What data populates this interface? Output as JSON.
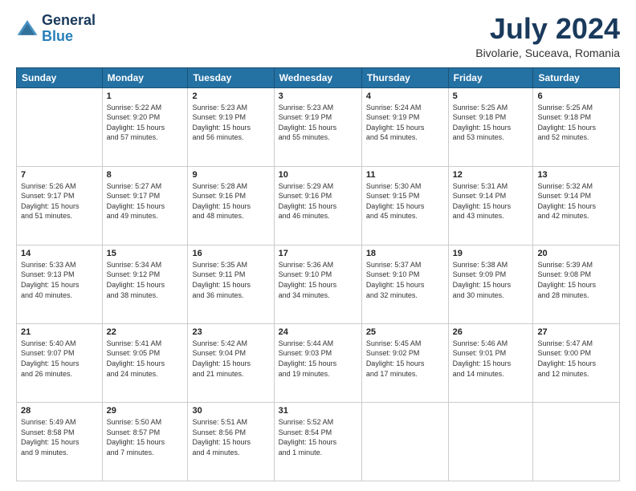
{
  "logo": {
    "line1": "General",
    "line2": "Blue"
  },
  "title": "July 2024",
  "location": "Bivolarie, Suceava, Romania",
  "header_days": [
    "Sunday",
    "Monday",
    "Tuesday",
    "Wednesday",
    "Thursday",
    "Friday",
    "Saturday"
  ],
  "weeks": [
    [
      {
        "day": "",
        "info": ""
      },
      {
        "day": "1",
        "info": "Sunrise: 5:22 AM\nSunset: 9:20 PM\nDaylight: 15 hours\nand 57 minutes."
      },
      {
        "day": "2",
        "info": "Sunrise: 5:23 AM\nSunset: 9:19 PM\nDaylight: 15 hours\nand 56 minutes."
      },
      {
        "day": "3",
        "info": "Sunrise: 5:23 AM\nSunset: 9:19 PM\nDaylight: 15 hours\nand 55 minutes."
      },
      {
        "day": "4",
        "info": "Sunrise: 5:24 AM\nSunset: 9:19 PM\nDaylight: 15 hours\nand 54 minutes."
      },
      {
        "day": "5",
        "info": "Sunrise: 5:25 AM\nSunset: 9:18 PM\nDaylight: 15 hours\nand 53 minutes."
      },
      {
        "day": "6",
        "info": "Sunrise: 5:25 AM\nSunset: 9:18 PM\nDaylight: 15 hours\nand 52 minutes."
      }
    ],
    [
      {
        "day": "7",
        "info": "Sunrise: 5:26 AM\nSunset: 9:17 PM\nDaylight: 15 hours\nand 51 minutes."
      },
      {
        "day": "8",
        "info": "Sunrise: 5:27 AM\nSunset: 9:17 PM\nDaylight: 15 hours\nand 49 minutes."
      },
      {
        "day": "9",
        "info": "Sunrise: 5:28 AM\nSunset: 9:16 PM\nDaylight: 15 hours\nand 48 minutes."
      },
      {
        "day": "10",
        "info": "Sunrise: 5:29 AM\nSunset: 9:16 PM\nDaylight: 15 hours\nand 46 minutes."
      },
      {
        "day": "11",
        "info": "Sunrise: 5:30 AM\nSunset: 9:15 PM\nDaylight: 15 hours\nand 45 minutes."
      },
      {
        "day": "12",
        "info": "Sunrise: 5:31 AM\nSunset: 9:14 PM\nDaylight: 15 hours\nand 43 minutes."
      },
      {
        "day": "13",
        "info": "Sunrise: 5:32 AM\nSunset: 9:14 PM\nDaylight: 15 hours\nand 42 minutes."
      }
    ],
    [
      {
        "day": "14",
        "info": "Sunrise: 5:33 AM\nSunset: 9:13 PM\nDaylight: 15 hours\nand 40 minutes."
      },
      {
        "day": "15",
        "info": "Sunrise: 5:34 AM\nSunset: 9:12 PM\nDaylight: 15 hours\nand 38 minutes."
      },
      {
        "day": "16",
        "info": "Sunrise: 5:35 AM\nSunset: 9:11 PM\nDaylight: 15 hours\nand 36 minutes."
      },
      {
        "day": "17",
        "info": "Sunrise: 5:36 AM\nSunset: 9:10 PM\nDaylight: 15 hours\nand 34 minutes."
      },
      {
        "day": "18",
        "info": "Sunrise: 5:37 AM\nSunset: 9:10 PM\nDaylight: 15 hours\nand 32 minutes."
      },
      {
        "day": "19",
        "info": "Sunrise: 5:38 AM\nSunset: 9:09 PM\nDaylight: 15 hours\nand 30 minutes."
      },
      {
        "day": "20",
        "info": "Sunrise: 5:39 AM\nSunset: 9:08 PM\nDaylight: 15 hours\nand 28 minutes."
      }
    ],
    [
      {
        "day": "21",
        "info": "Sunrise: 5:40 AM\nSunset: 9:07 PM\nDaylight: 15 hours\nand 26 minutes."
      },
      {
        "day": "22",
        "info": "Sunrise: 5:41 AM\nSunset: 9:05 PM\nDaylight: 15 hours\nand 24 minutes."
      },
      {
        "day": "23",
        "info": "Sunrise: 5:42 AM\nSunset: 9:04 PM\nDaylight: 15 hours\nand 21 minutes."
      },
      {
        "day": "24",
        "info": "Sunrise: 5:44 AM\nSunset: 9:03 PM\nDaylight: 15 hours\nand 19 minutes."
      },
      {
        "day": "25",
        "info": "Sunrise: 5:45 AM\nSunset: 9:02 PM\nDaylight: 15 hours\nand 17 minutes."
      },
      {
        "day": "26",
        "info": "Sunrise: 5:46 AM\nSunset: 9:01 PM\nDaylight: 15 hours\nand 14 minutes."
      },
      {
        "day": "27",
        "info": "Sunrise: 5:47 AM\nSunset: 9:00 PM\nDaylight: 15 hours\nand 12 minutes."
      }
    ],
    [
      {
        "day": "28",
        "info": "Sunrise: 5:49 AM\nSunset: 8:58 PM\nDaylight: 15 hours\nand 9 minutes."
      },
      {
        "day": "29",
        "info": "Sunrise: 5:50 AM\nSunset: 8:57 PM\nDaylight: 15 hours\nand 7 minutes."
      },
      {
        "day": "30",
        "info": "Sunrise: 5:51 AM\nSunset: 8:56 PM\nDaylight: 15 hours\nand 4 minutes."
      },
      {
        "day": "31",
        "info": "Sunrise: 5:52 AM\nSunset: 8:54 PM\nDaylight: 15 hours\nand 1 minute."
      },
      {
        "day": "",
        "info": ""
      },
      {
        "day": "",
        "info": ""
      },
      {
        "day": "",
        "info": ""
      }
    ]
  ]
}
